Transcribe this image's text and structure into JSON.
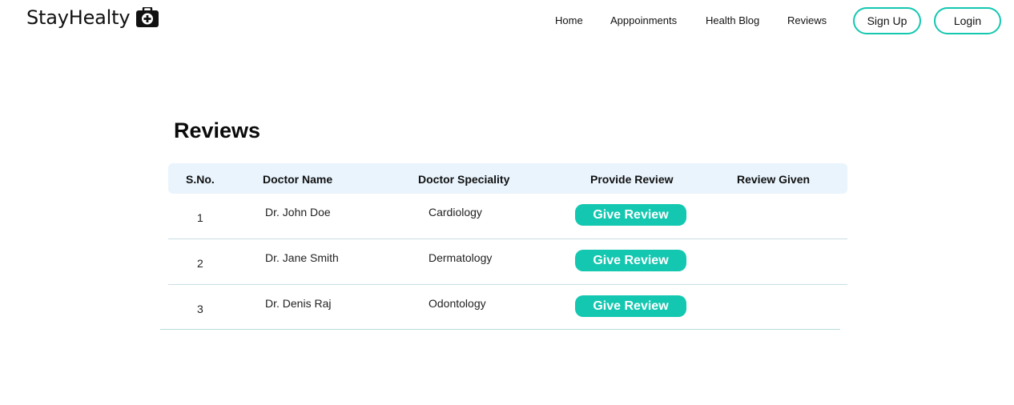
{
  "brand": {
    "name": "StayHealty",
    "icon": "medical-bag-icon"
  },
  "nav": {
    "links": [
      "Home",
      "Apppoinments",
      "Health Blog",
      "Reviews"
    ],
    "signup_label": "Sign Up",
    "login_label": "Login"
  },
  "page": {
    "title": "Reviews"
  },
  "table": {
    "headers": [
      "S.No.",
      "Doctor Name",
      "Doctor Speciality",
      "Provide Review",
      "Review Given"
    ],
    "rows": [
      {
        "sno": "1",
        "doctor": "Dr. John Doe",
        "speciality": "Cardiology",
        "action": "Give Review",
        "given": ""
      },
      {
        "sno": "2",
        "doctor": "Dr. Jane Smith",
        "speciality": "Dermatology",
        "action": "Give Review",
        "given": ""
      },
      {
        "sno": "3",
        "doctor": "Dr. Denis Raj",
        "speciality": "Odontology",
        "action": "Give Review",
        "given": ""
      }
    ]
  },
  "colors": {
    "accent": "#13c7b0",
    "header_bg": "#e9f4fd",
    "divider": "#c8dfe4"
  }
}
